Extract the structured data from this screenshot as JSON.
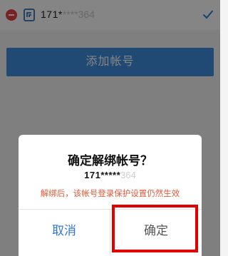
{
  "account_row": {
    "visible_digits": "171*",
    "masked_suffix": "****364"
  },
  "add_account_label": "添加帐号",
  "dialog": {
    "title": "确定解绑帐号？",
    "account_visible": "171*****",
    "account_masked": "364",
    "warning": "解绑后，该帐号登录保护设置仍然生效",
    "cancel_label": "取消",
    "confirm_label": "确定"
  },
  "colors": {
    "accent": "#3f8fdd",
    "cancel_text": "#3377cc",
    "warning_text": "#e25b3b",
    "remove_icon": "#e64340",
    "highlight": "#e00000"
  },
  "icons": {
    "remove": "minus-circle-icon",
    "account": "qq-token-icon",
    "check": "check-icon"
  }
}
